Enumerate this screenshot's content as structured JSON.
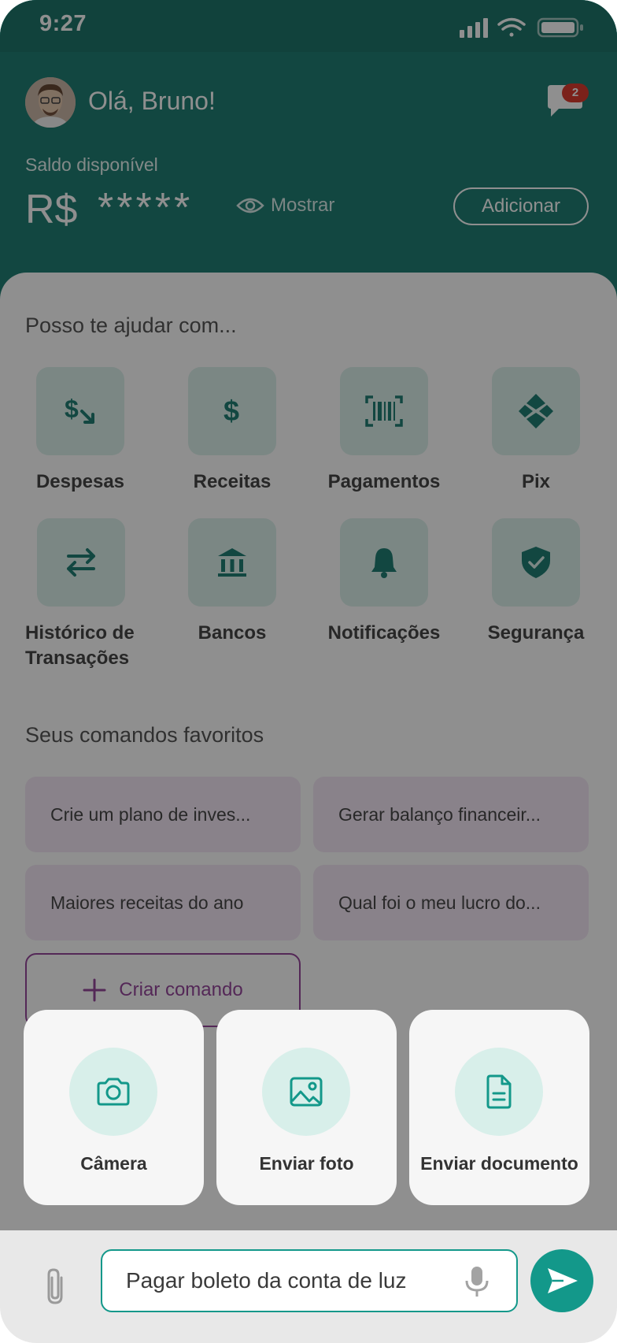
{
  "status_bar": {
    "time": "9:27"
  },
  "header": {
    "greeting": "Olá, Bruno!",
    "notification_count": "2",
    "balance_label": "Saldo disponível",
    "currency": "R$",
    "masked_value": "*****",
    "show_label": "Mostrar",
    "add_label": "Adicionar"
  },
  "help": {
    "title": "Posso te ajudar com...",
    "actions": [
      {
        "label": "Despesas",
        "icon": "expense-icon"
      },
      {
        "label": "Receitas",
        "icon": "dollar-icon"
      },
      {
        "label": "Pagamentos",
        "icon": "barcode-icon"
      },
      {
        "label": "Pix",
        "icon": "pix-icon"
      },
      {
        "label": "Histórico de Transações",
        "icon": "transfer-arrows-icon"
      },
      {
        "label": "Bancos",
        "icon": "bank-icon"
      },
      {
        "label": "Notificações",
        "icon": "bell-icon"
      },
      {
        "label": "Segurança",
        "icon": "shield-check-icon"
      }
    ]
  },
  "favorites": {
    "title": "Seus comandos favoritos",
    "items": [
      "Crie um plano de inves...",
      "Gerar balanço financeir...",
      "Maiores receitas do ano",
      "Qual foi o meu lucro do..."
    ],
    "create_label": "Criar comando"
  },
  "attachments": [
    {
      "label": "Câmera",
      "icon": "camera-icon"
    },
    {
      "label": "Enviar foto",
      "icon": "image-icon"
    },
    {
      "label": "Enviar documento",
      "icon": "document-icon"
    }
  ],
  "composer": {
    "text": "Pagar boleto da conta de luz"
  },
  "colors": {
    "primary": "#11766a",
    "accent": "#13988a",
    "tile": "#d9efea",
    "favorite_bg": "#f4e7f6",
    "purple": "#8e3a95",
    "badge": "#d92d20"
  }
}
